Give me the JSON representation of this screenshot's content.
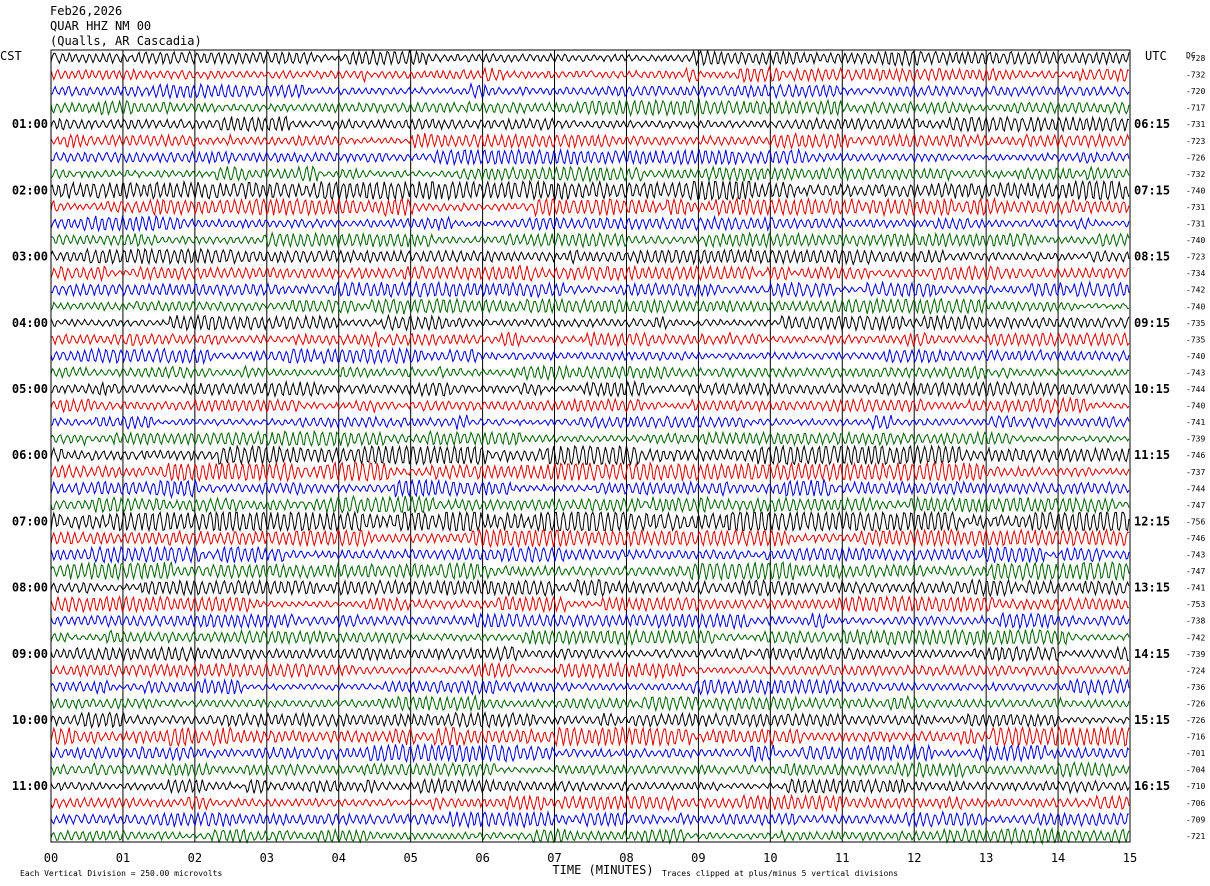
{
  "header": {
    "date": "Feb26,2026",
    "station": "QUAR HHZ NM 00",
    "location": "(Qualls, AR Cascadia)"
  },
  "left_timezone": "CST",
  "right_timezone": "UTC",
  "dc_label": "DC",
  "left_time_labels": [
    "01:00",
    "02:00",
    "03:00",
    "04:00",
    "05:00",
    "06:00",
    "07:00",
    "08:00",
    "09:00",
    "10:00",
    "11:00"
  ],
  "right_time_labels": [
    "06:15",
    "07:15",
    "08:15",
    "09:15",
    "10:15",
    "11:15",
    "12:15",
    "13:15",
    "14:15",
    "15:15",
    "16:15"
  ],
  "footer": {
    "scale_note": "Each Vertical Division =  250.00 microvolts",
    "clip_note": "Traces clipped at plus/minus 5 vertical divisions"
  },
  "colors": {
    "trace_cycle": [
      "#000000",
      "#e00000",
      "#0000e0",
      "#006400"
    ],
    "grid": "#000000",
    "background": "#ffffff"
  },
  "chart_data": {
    "type": "line",
    "title": "QUAR HHZ NM 00",
    "xlabel": "TIME (MINUTES)",
    "ylabel": "",
    "x_ticks": [
      "00",
      "01",
      "02",
      "03",
      "04",
      "05",
      "06",
      "07",
      "08",
      "09",
      "10",
      "11",
      "12",
      "13",
      "14",
      "15"
    ],
    "xlim": [
      0,
      15
    ],
    "trace_count": 48,
    "minutes_per_trace": 15,
    "dc_offsets": [
      -728,
      -732,
      -720,
      -717,
      -731,
      -723,
      -726,
      -732,
      -740,
      -731,
      -731,
      -740,
      -723,
      -734,
      -742,
      -740,
      -735,
      -735,
      -740,
      -743,
      -744,
      -740,
      -741,
      -739,
      -746,
      -737,
      -744,
      -747,
      -756,
      -746,
      -743,
      -747,
      -741,
      -753,
      -738,
      -742,
      -739,
      -724,
      -736,
      -726,
      -726,
      -716,
      -701,
      -704,
      -710,
      -706,
      -709,
      -721
    ],
    "trace_activity": [
      1.0,
      1.0,
      1.0,
      1.0,
      1.0,
      1.0,
      1.0,
      1.0,
      1.6,
      1.2,
      1.0,
      1.0,
      1.0,
      1.0,
      1.0,
      1.0,
      1.0,
      1.0,
      1.0,
      1.0,
      1.0,
      1.0,
      1.0,
      1.0,
      1.5,
      1.3,
      1.2,
      1.2,
      2.0,
      1.2,
      1.1,
      1.2,
      1.1,
      1.0,
      1.0,
      1.0,
      1.0,
      1.0,
      1.0,
      1.0,
      1.1,
      1.4,
      1.2,
      1.0,
      1.0,
      1.0,
      1.0,
      1.0
    ]
  }
}
